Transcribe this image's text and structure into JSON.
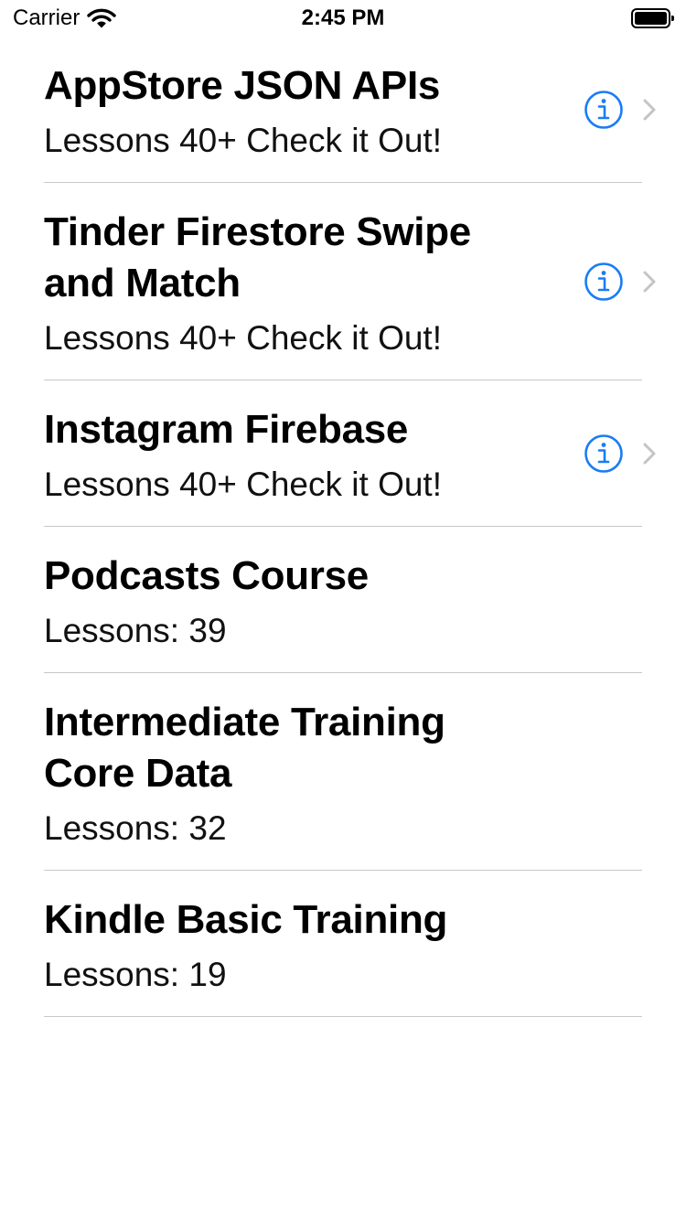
{
  "status_bar": {
    "carrier": "Carrier",
    "time": "2:45 PM",
    "wifi_icon": "wifi-icon",
    "battery_icon": "battery-icon"
  },
  "courses": [
    {
      "title": "AppStore JSON APIs",
      "subtitle": "Lessons 40+ Check it Out!",
      "accessory": "detail-disclosure"
    },
    {
      "title": "Tinder Firestore Swipe and Match",
      "subtitle": "Lessons 40+ Check it Out!",
      "accessory": "detail-disclosure"
    },
    {
      "title": "Instagram Firebase",
      "subtitle": "Lessons 40+ Check it Out!",
      "accessory": "detail-disclosure"
    },
    {
      "title": "Podcasts Course",
      "subtitle": "Lessons: 39",
      "accessory": "none"
    },
    {
      "title": "Intermediate Training Core Data",
      "subtitle": "Lessons: 32",
      "accessory": "none"
    },
    {
      "title": "Kindle Basic Training",
      "subtitle": "Lessons: 19",
      "accessory": "none"
    }
  ],
  "colors": {
    "accent": "#1a7cf5",
    "chevron": "#c4c4c7",
    "separator": "#c8c7cc"
  }
}
